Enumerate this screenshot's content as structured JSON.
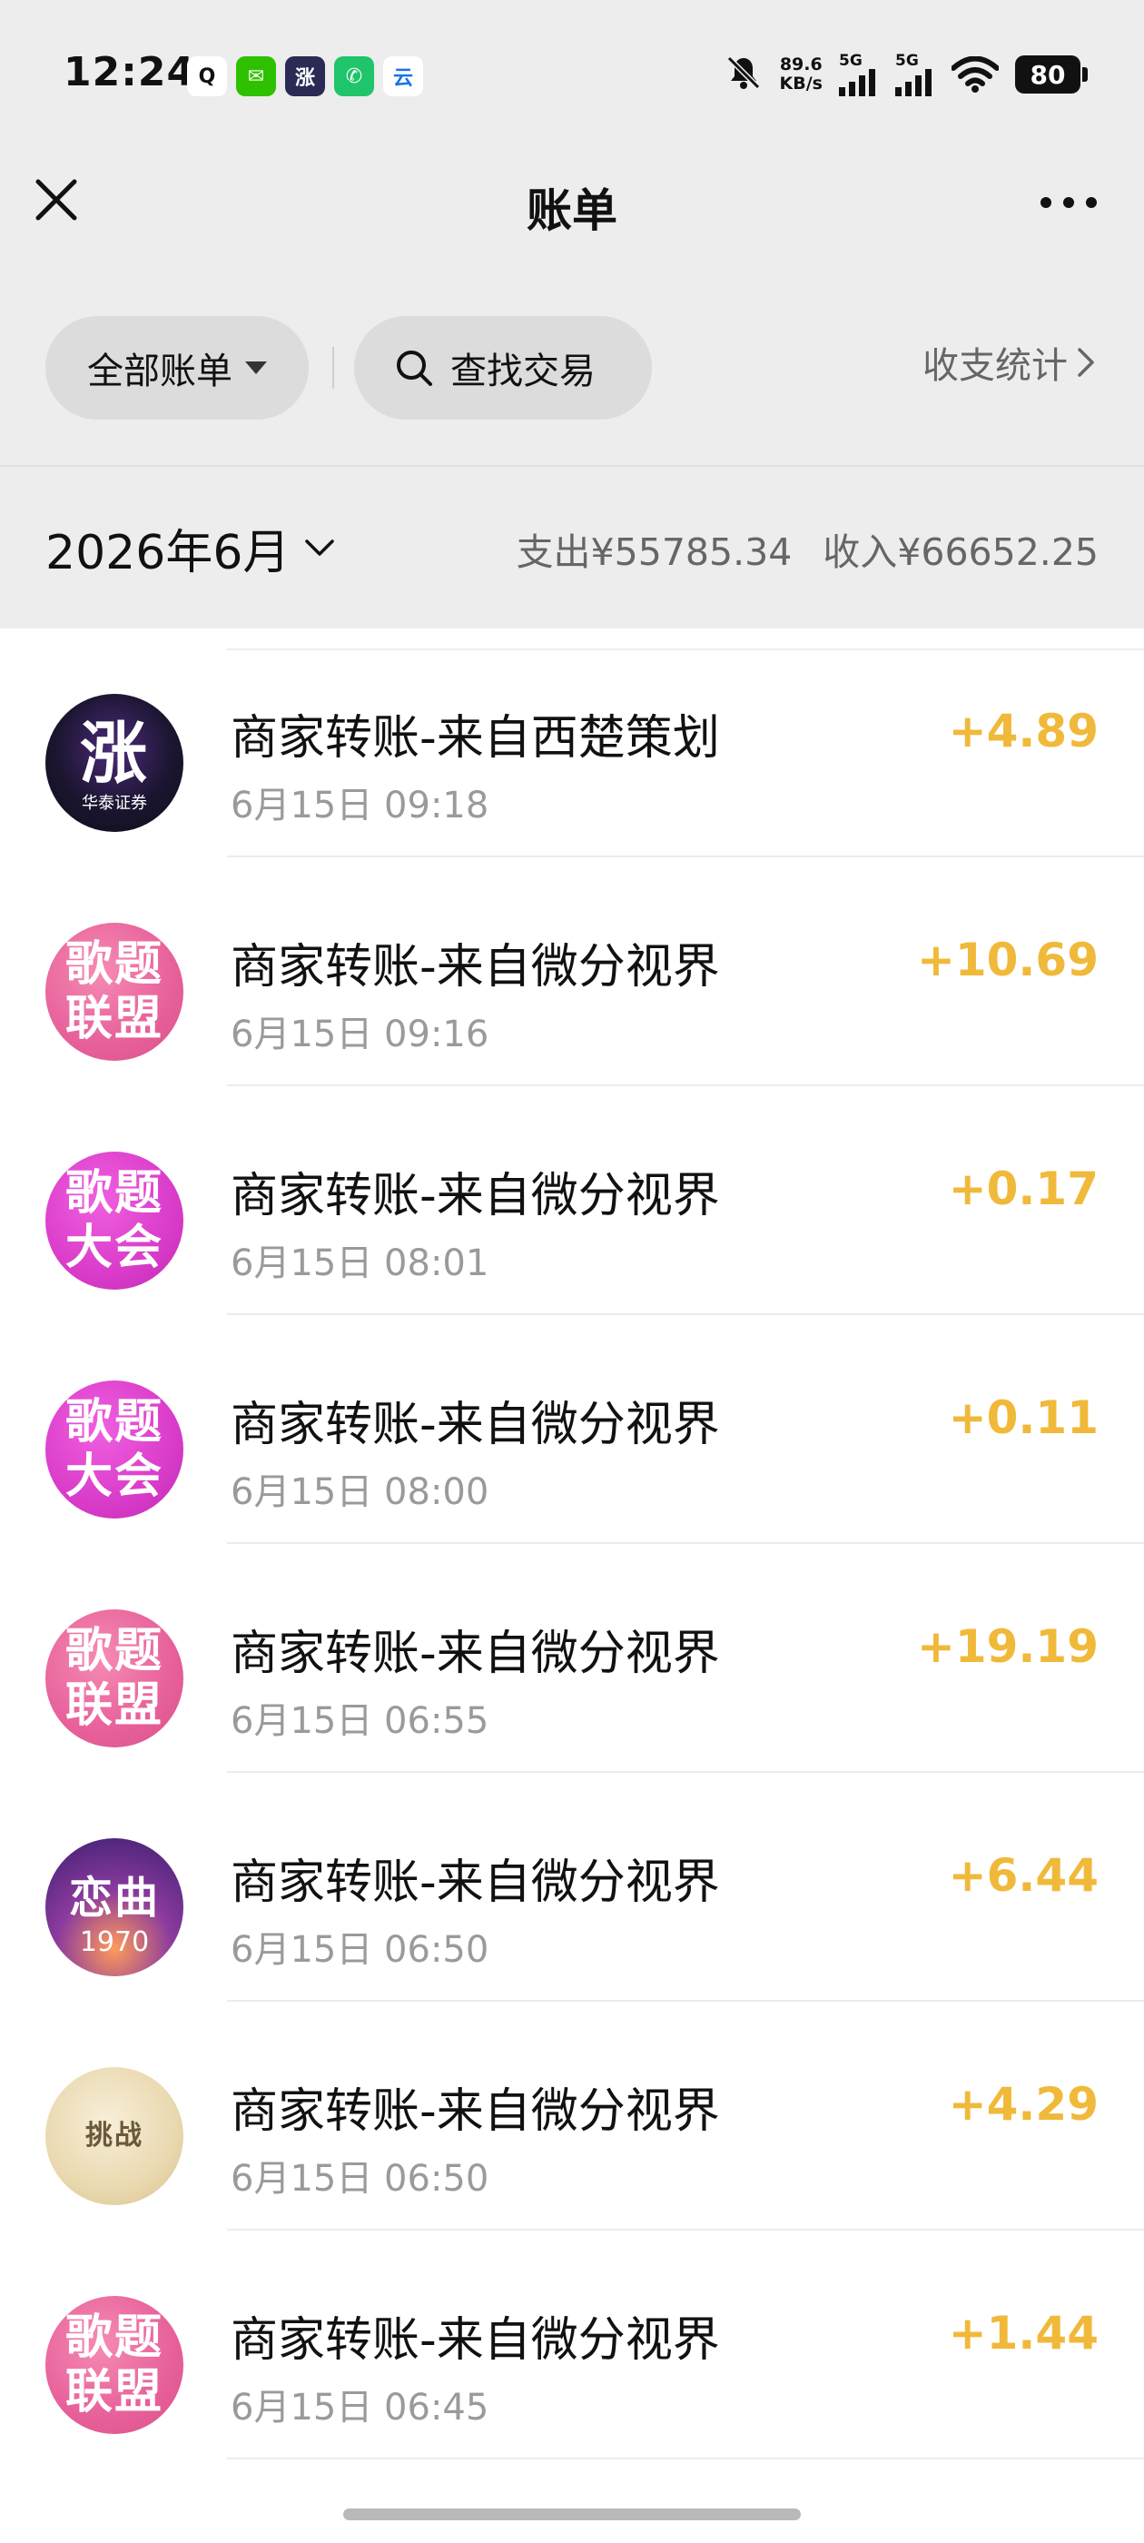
{
  "status_bar": {
    "time": "12:24",
    "net_speed_value": "89.6",
    "net_speed_unit": "KB/s",
    "signal1_label": "5G",
    "signal2_label": "5G",
    "battery": "80",
    "app_icons": [
      {
        "name": "qq-icon",
        "color": "#ffffff",
        "glyph": "Q",
        "fg": "#111111"
      },
      {
        "name": "wechat-icon",
        "color": "#2dc100",
        "glyph": "✉",
        "fg": "#ffffff"
      },
      {
        "name": "zhang-icon",
        "color": "#2a2a55",
        "glyph": "涨",
        "fg": "#ffffff"
      },
      {
        "name": "phone-icon",
        "color": "#1fc46b",
        "glyph": "✆",
        "fg": "#ffffff"
      },
      {
        "name": "cloud-icon",
        "color": "#ffffff",
        "glyph": "云",
        "fg": "#1a73e8"
      }
    ]
  },
  "nav": {
    "title": "账单"
  },
  "filters": {
    "all_label": "全部账单",
    "search_label": "查找交易",
    "stats_label": "收支统计"
  },
  "month": {
    "label": "2026年6月",
    "expense": "支出¥55785.34",
    "income": "收入¥66652.25"
  },
  "colors": {
    "amount": "#f0b93a",
    "background_top": "#ededed"
  },
  "transactions": [
    {
      "title": "商家转账-来自西楚策划",
      "date": "6月15日 09:18",
      "amount": "+4.89",
      "avatar_style": "dark",
      "avatar_text": "涨",
      "avatar_sub": "华泰证券"
    },
    {
      "title": "商家转账-来自微分视界",
      "date": "6月15日 09:16",
      "amount": "+10.69",
      "avatar_style": "pink",
      "avatar_text": "歌题\n联盟",
      "avatar_sub": ""
    },
    {
      "title": "商家转账-来自微分视界",
      "date": "6月15日 08:01",
      "amount": "+0.17",
      "avatar_style": "magenta",
      "avatar_text": "歌题\n大会",
      "avatar_sub": ""
    },
    {
      "title": "商家转账-来自微分视界",
      "date": "6月15日 08:00",
      "amount": "+0.11",
      "avatar_style": "magenta",
      "avatar_text": "歌题\n大会",
      "avatar_sub": ""
    },
    {
      "title": "商家转账-来自微分视界",
      "date": "6月15日 06:55",
      "amount": "+19.19",
      "avatar_style": "pink",
      "avatar_text": "歌题\n联盟",
      "avatar_sub": ""
    },
    {
      "title": "商家转账-来自微分视界",
      "date": "6月15日 06:50",
      "amount": "+6.44",
      "avatar_style": "purple",
      "avatar_text": "恋曲",
      "avatar_sub": "1970"
    },
    {
      "title": "商家转账-来自微分视界",
      "date": "6月15日 06:50",
      "amount": "+4.29",
      "avatar_style": "beige",
      "avatar_text": "挑战",
      "avatar_sub": ""
    },
    {
      "title": "商家转账-来自微分视界",
      "date": "6月15日 06:45",
      "amount": "+1.44",
      "avatar_style": "pink",
      "avatar_text": "歌题\n联盟",
      "avatar_sub": ""
    }
  ]
}
